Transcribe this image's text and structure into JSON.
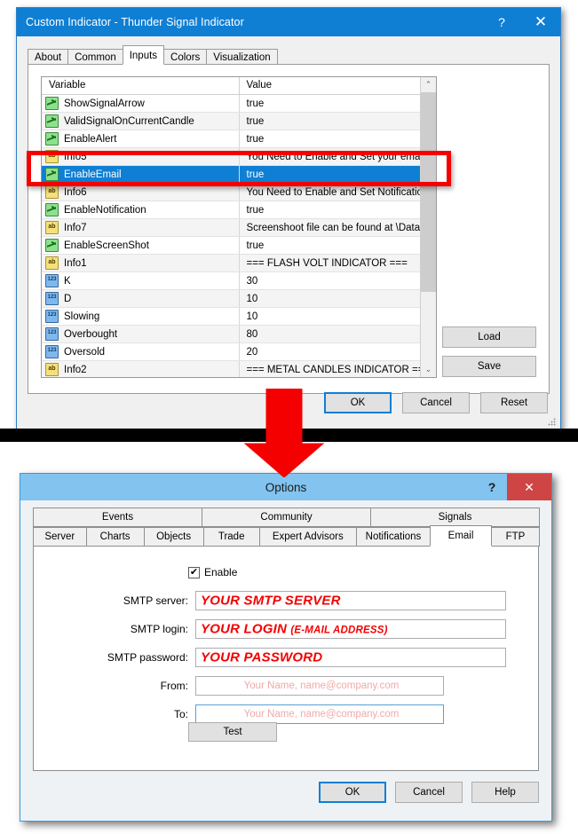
{
  "indicator_dialog": {
    "title": "Custom Indicator - Thunder Signal Indicator",
    "help_icon": "?",
    "close_icon": "✕",
    "tabs": [
      {
        "label": "About",
        "selected": false
      },
      {
        "label": "Common",
        "selected": false
      },
      {
        "label": "Inputs",
        "selected": true
      },
      {
        "label": "Colors",
        "selected": false
      },
      {
        "label": "Visualization",
        "selected": false
      }
    ],
    "table": {
      "headers": [
        "Variable",
        "Value"
      ],
      "rows": [
        {
          "icon": "bool-icon",
          "type": "bool",
          "variable": "ShowSignalArrow",
          "value": "true",
          "selected": false
        },
        {
          "icon": "bool-icon",
          "type": "bool",
          "variable": "ValidSignalOnCurrentCandle",
          "value": "true",
          "selected": false
        },
        {
          "icon": "bool-icon",
          "type": "bool",
          "variable": "EnableAlert",
          "value": "true",
          "selected": false
        },
        {
          "icon": "string-icon",
          "type": "str",
          "variable": "Info5",
          "value": "You Need to Enable and Set your email se...",
          "selected": false
        },
        {
          "icon": "bool-icon",
          "type": "bool",
          "variable": "EnableEmail",
          "value": "true",
          "selected": true
        },
        {
          "icon": "string-icon",
          "type": "str",
          "variable": "Info6",
          "value": "You Need to Enable and Set Notifications i...",
          "selected": false
        },
        {
          "icon": "bool-icon",
          "type": "bool",
          "variable": "EnableNotification",
          "value": "true",
          "selected": false
        },
        {
          "icon": "string-icon",
          "type": "str",
          "variable": "Info7",
          "value": "Screenshoot file can be found at \\Data Fol...",
          "selected": false
        },
        {
          "icon": "bool-icon",
          "type": "bool",
          "variable": "EnableScreenShot",
          "value": "true",
          "selected": false
        },
        {
          "icon": "string-icon",
          "type": "str",
          "variable": "Info1",
          "value": "=== FLASH VOLT INDICATOR ===",
          "selected": false
        },
        {
          "icon": "number-icon",
          "type": "num",
          "variable": "K",
          "value": "30",
          "selected": false
        },
        {
          "icon": "number-icon",
          "type": "num",
          "variable": "D",
          "value": "10",
          "selected": false
        },
        {
          "icon": "number-icon",
          "type": "num",
          "variable": "Slowing",
          "value": "10",
          "selected": false
        },
        {
          "icon": "number-icon",
          "type": "num",
          "variable": "Overbought",
          "value": "80",
          "selected": false
        },
        {
          "icon": "number-icon",
          "type": "num",
          "variable": "Oversold",
          "value": "20",
          "selected": false
        },
        {
          "icon": "string-icon",
          "type": "str",
          "variable": "Info2",
          "value": "=== METAL CANDLES INDICATOR ===",
          "selected": false
        }
      ]
    },
    "side_buttons": {
      "load": "Load",
      "save": "Save"
    },
    "footer_buttons": {
      "ok": "OK",
      "cancel": "Cancel",
      "reset": "Reset"
    },
    "scroll_up_icon": "⌃",
    "scroll_down_icon": "⌄"
  },
  "options_dialog": {
    "title": "Options",
    "help_icon": "?",
    "close_icon": "✕",
    "tabs_row1": [
      {
        "label": "Events",
        "selected": false
      },
      {
        "label": "Community",
        "selected": false
      },
      {
        "label": "Signals",
        "selected": false
      }
    ],
    "tabs_row2": [
      {
        "label": "Server",
        "selected": false
      },
      {
        "label": "Charts",
        "selected": false
      },
      {
        "label": "Objects",
        "selected": false
      },
      {
        "label": "Trade",
        "selected": false
      },
      {
        "label": "Expert Advisors",
        "selected": false
      },
      {
        "label": "Notifications",
        "selected": false
      },
      {
        "label": "Email",
        "selected": true
      },
      {
        "label": "FTP",
        "selected": false
      }
    ],
    "enable": {
      "label": "Enable",
      "checked": true,
      "check_glyph": "✔"
    },
    "fields": [
      {
        "label": "SMTP server:",
        "annotation": "YOUR SMTP SERVER",
        "annotation_suffix": "",
        "value": "",
        "placeholder": ""
      },
      {
        "label": "SMTP login:",
        "annotation": "YOUR LOGIN ",
        "annotation_suffix": "(E-MAIL ADDRESS)",
        "value": "",
        "placeholder": ""
      },
      {
        "label": "SMTP password:",
        "annotation": "YOUR PASSWORD",
        "annotation_suffix": "",
        "value": "",
        "placeholder": ""
      },
      {
        "label": "From:",
        "annotation": "",
        "annotation_suffix": "",
        "value": "",
        "placeholder": "Your Name, name@company.com"
      },
      {
        "label": "To:",
        "annotation": "",
        "annotation_suffix": "",
        "value": "",
        "placeholder": "Your Name, name@company.com"
      }
    ],
    "test_button": "Test",
    "footer_buttons": {
      "ok": "OK",
      "cancel": "Cancel",
      "help": "Help"
    }
  },
  "annotations": {
    "arrow": "red-down-arrow",
    "highlight": "red-rectangle-around-enable-email-row"
  },
  "colors": {
    "indicator_titlebar": "#0f7fd4",
    "options_titlebar": "#82c3ef",
    "selection": "#0f7fd4",
    "annotation_red": "#f40000",
    "close_button_red": "#cf4444",
    "placeholder_pink": "#f2a8a8"
  }
}
